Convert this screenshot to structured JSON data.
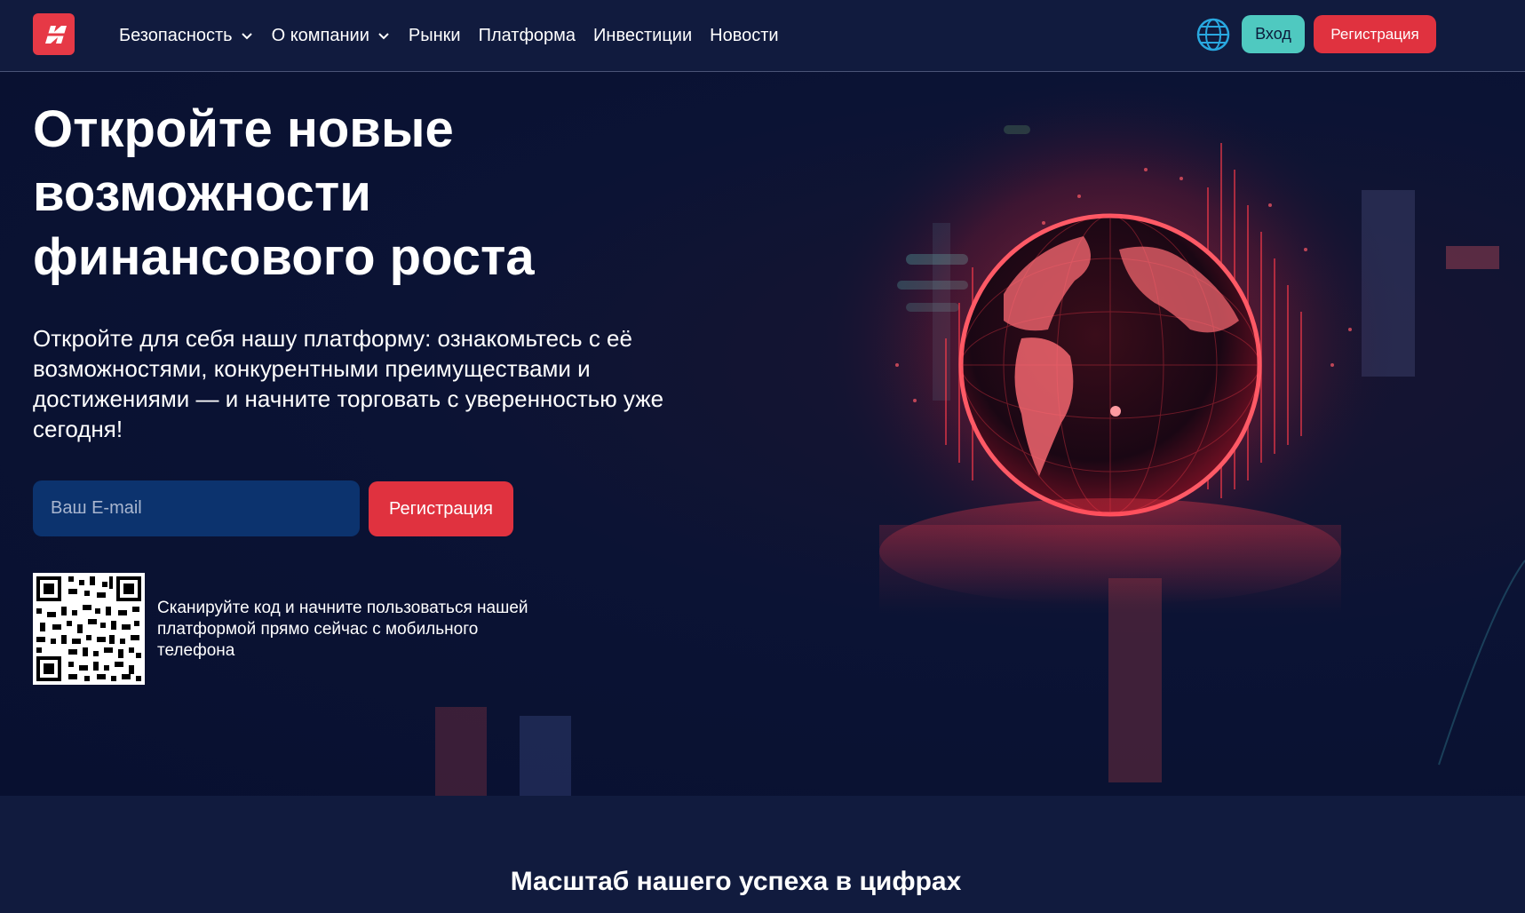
{
  "header": {
    "logo_icon": "brand-logo-icon",
    "nav": [
      {
        "label": "Безопасность",
        "has_dropdown": true
      },
      {
        "label": "О компании",
        "has_dropdown": true
      },
      {
        "label": "Рынки",
        "has_dropdown": false
      },
      {
        "label": "Платформа",
        "has_dropdown": false
      },
      {
        "label": "Инвестиции",
        "has_dropdown": false
      },
      {
        "label": "Новости",
        "has_dropdown": false
      }
    ],
    "language_icon": "globe-icon",
    "login_label": "Вход",
    "register_label": "Регистрация"
  },
  "hero": {
    "title_lines": [
      "Откройте новые",
      "возможности",
      "финансового роста"
    ],
    "description": "Откройте для себя нашу платформу: ознакомьтесь с её возможностями, конкурентными преимуществами и достижениями — и начните торговать с уверенностью уже сегодня!",
    "email_placeholder": "Ваш E-mail",
    "register_label": "Регистрация",
    "qr_text": "Сканируйте код и начните пользоваться нашей платформой прямо сейчас с мобильного телефона"
  },
  "stats": {
    "title": "Масштаб нашего успеха в цифрах"
  },
  "colors": {
    "accent_red": "#e0323f",
    "accent_teal": "#4fc9c0",
    "header_bg": "#111b3e",
    "hero_bg": "#0b1334",
    "input_bg": "#0c336e"
  }
}
